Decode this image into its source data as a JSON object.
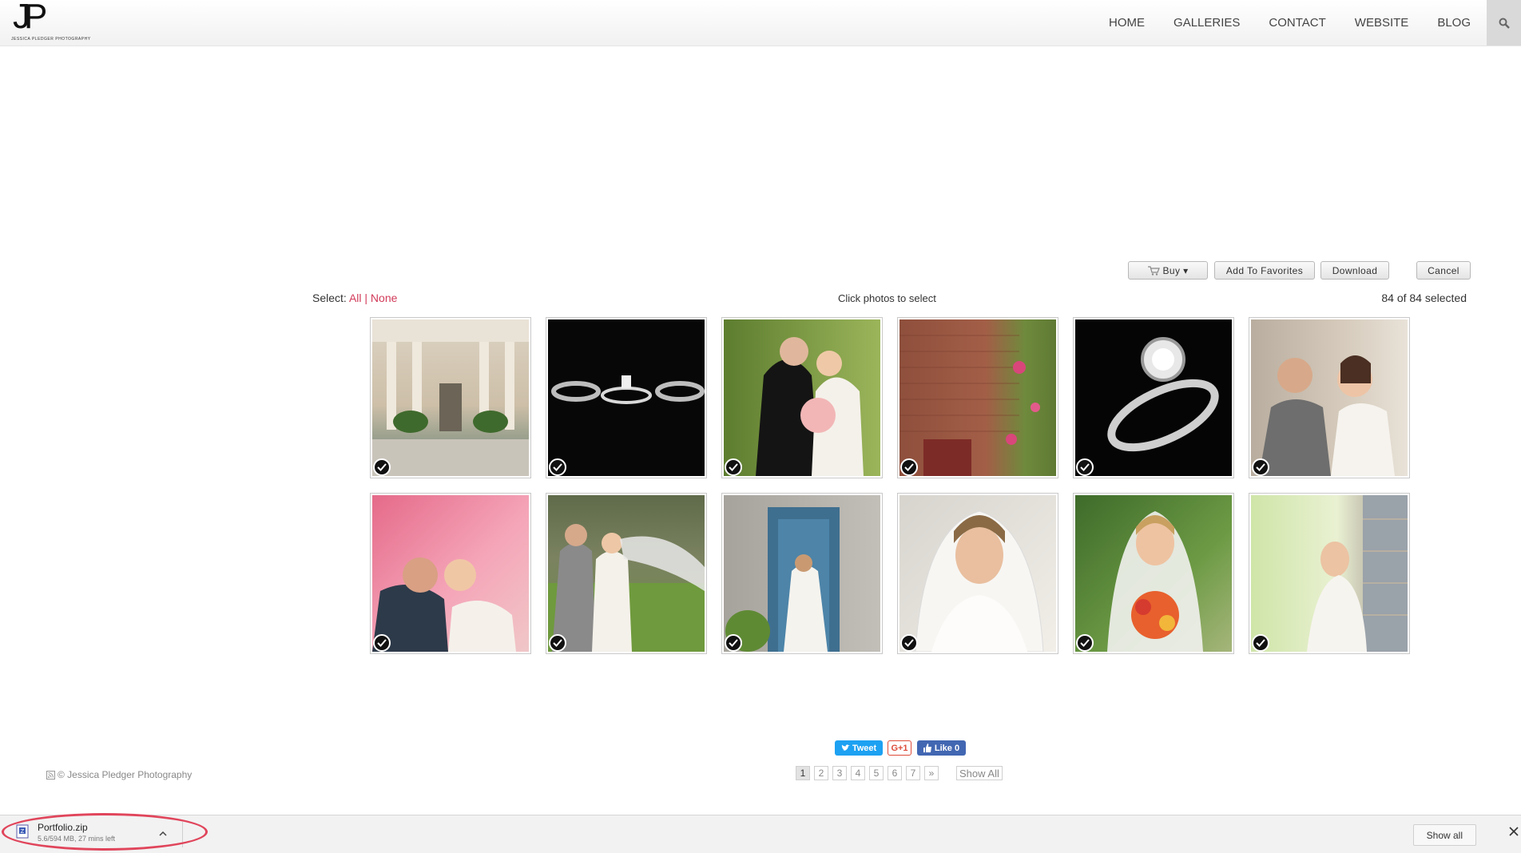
{
  "header": {
    "logo_mark": "JP",
    "logo_sub": "JESSICA PLEDGER PHOTOGRAPHY",
    "nav": [
      {
        "label": "HOME"
      },
      {
        "label": "GALLERIES"
      },
      {
        "label": "CONTACT"
      },
      {
        "label": "WEBSITE"
      },
      {
        "label": "BLOG"
      }
    ],
    "search_icon": "search-icon"
  },
  "toolbar": {
    "buy_label": "Buy ▾",
    "favorites_label": "Add To Favorites",
    "download_label": "Download",
    "cancel_label": "Cancel"
  },
  "selection": {
    "select_label": "Select:",
    "all_label": "All",
    "divider": "|",
    "none_label": "None",
    "hint": "Click photos to select",
    "count": "84 of 84 selected"
  },
  "photos": [
    {
      "subject": "museum columns couple",
      "selected": true
    },
    {
      "subject": "wedding rings on black",
      "selected": true
    },
    {
      "subject": "couple kiss on forehead",
      "selected": true
    },
    {
      "subject": "brick wall with flowers",
      "selected": true
    },
    {
      "subject": "engagement ring close-up",
      "selected": true
    },
    {
      "subject": "couple in ceremony",
      "selected": true
    },
    {
      "subject": "couple kiss pink background",
      "selected": true
    },
    {
      "subject": "bride and groom with veil",
      "selected": true
    },
    {
      "subject": "bride at blue door",
      "selected": true
    },
    {
      "subject": "bride looking down",
      "selected": true
    },
    {
      "subject": "bride smiling with bouquet",
      "selected": true
    },
    {
      "subject": "bride by brick pillar",
      "selected": true
    }
  ],
  "social": {
    "tweet": "Tweet",
    "gplus": "G+1",
    "like": "Like 0"
  },
  "pagination": {
    "pages": [
      "1",
      "2",
      "3",
      "4",
      "5",
      "6",
      "7",
      "»"
    ],
    "current": "1",
    "show_all": "Show All"
  },
  "footer": {
    "copyright": "© Jessica Pledger Photography"
  },
  "download_bar": {
    "file_name": "Portfolio.zip",
    "status": "5.6/594 MB, 27 mins left",
    "show_all": "Show all"
  },
  "colors": {
    "link": "#d23b5a",
    "twitter": "#1da1f2",
    "facebook": "#4267b2",
    "gplus": "#dd4b39",
    "annotation": "#e0455b"
  }
}
